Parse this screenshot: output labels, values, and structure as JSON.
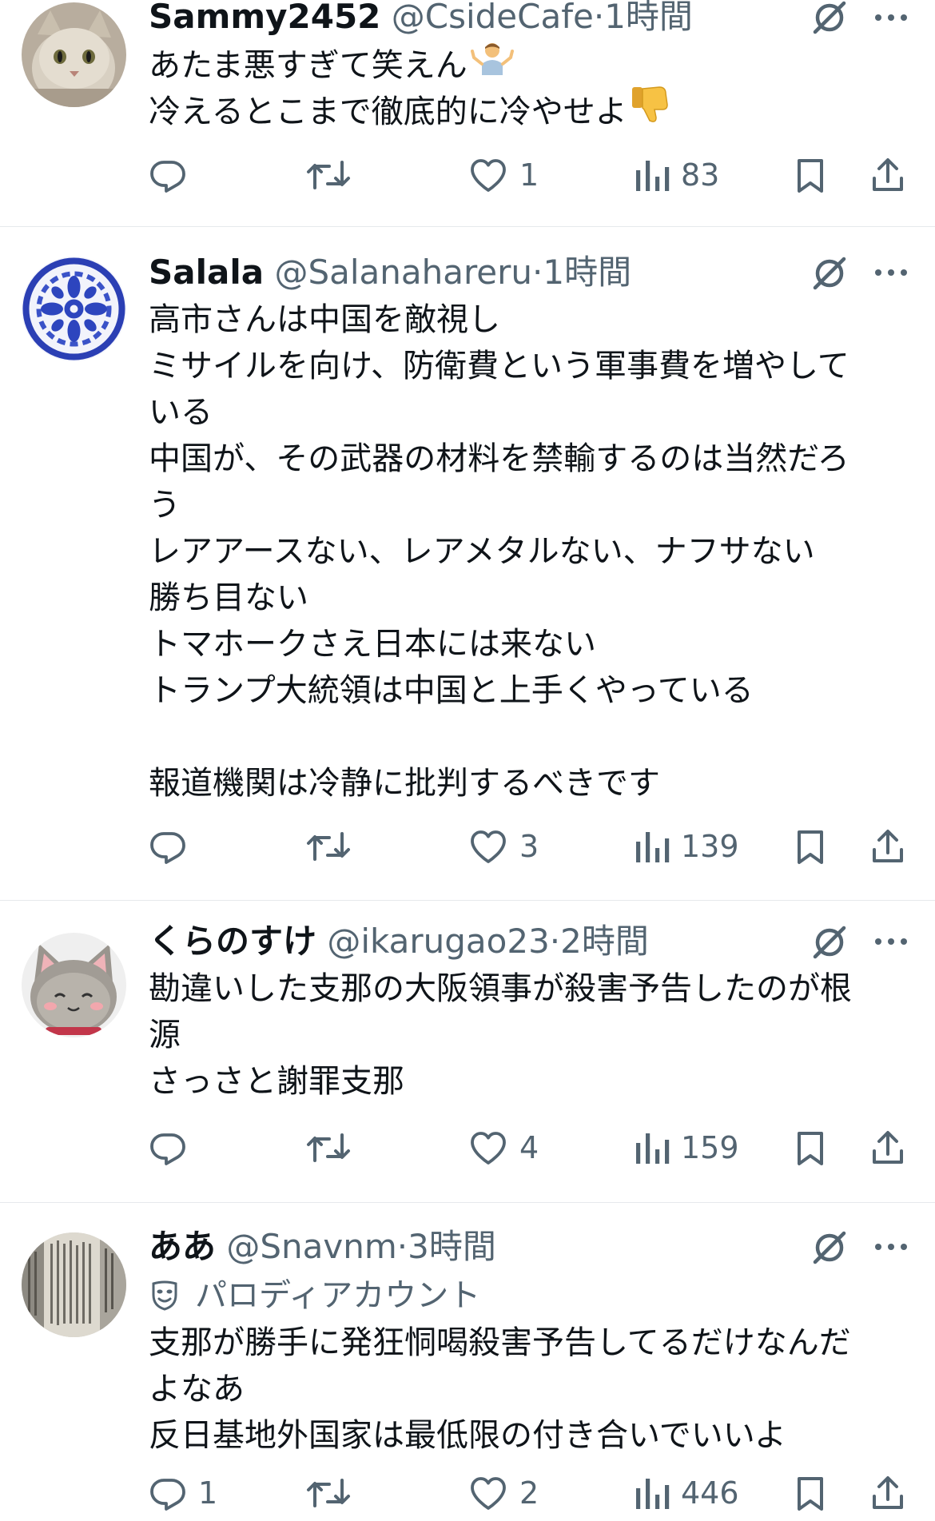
{
  "tweets": [
    {
      "display_name": "Sammy2452",
      "handle": "@CsideCafe",
      "separator": "·",
      "time": "1時間",
      "parody_label": "",
      "lines": [
        "あたま悪すぎて笑えん",
        "冷えるとこまで徹底的に冷やせよ"
      ],
      "emoji": [
        "person-shrugging-emoji",
        "thumbs-down-emoji"
      ],
      "reply_count": "",
      "retweet_count": "",
      "like_count": "1",
      "view_count": "83"
    },
    {
      "display_name": "Salala",
      "handle": "@Salanahareru",
      "separator": "·",
      "time": "1時間",
      "parody_label": "",
      "lines": [
        "高市さんは中国を敵視し",
        "ミサイルを向け、防衛費という軍事費を増やして",
        "いる",
        "中国が、その武器の材料を禁輸するのは当然だろ",
        "う",
        "レアアースない、レアメタルない、ナフサない",
        "勝ち目ない",
        "トマホークさえ日本には来ない",
        "トランプ大統領は中国と上手くやっている",
        "",
        "報道機関は冷静に批判するべきです"
      ],
      "reply_count": "",
      "retweet_count": "",
      "like_count": "3",
      "view_count": "139"
    },
    {
      "display_name": "くらのすけ",
      "handle": "@ikarugao23",
      "separator": "·",
      "time": "2時間",
      "parody_label": "",
      "lines": [
        "勘違いした支那の大阪領事が殺害予告したのが根",
        "源",
        "さっさと謝罪支那"
      ],
      "reply_count": "",
      "retweet_count": "",
      "like_count": "4",
      "view_count": "159"
    },
    {
      "display_name": "ああ",
      "handle": "@Snavnm",
      "separator": "·",
      "time": "3時間",
      "parody_label": "パロディアカウント",
      "lines": [
        "支那が勝手に発狂恫喝殺害予告してるだけなんだ",
        "よなあ",
        "反日基地外国家は最低限の付き合いでいいよ"
      ],
      "reply_count": "1",
      "retweet_count": "",
      "like_count": "2",
      "view_count": "446"
    }
  ],
  "icons": {
    "reply": "reply-icon",
    "retweet": "retweet-icon",
    "like": "heart-icon",
    "views": "views-icon",
    "bookmark": "bookmark-icon",
    "share": "share-icon",
    "grok": "grok-icon",
    "more": "more-icon",
    "parody": "parody-mask-icon"
  },
  "colors": {
    "text_primary": "#0f1419",
    "text_secondary": "#536471",
    "divider": "#e6e9ec",
    "background": "#ffffff"
  }
}
